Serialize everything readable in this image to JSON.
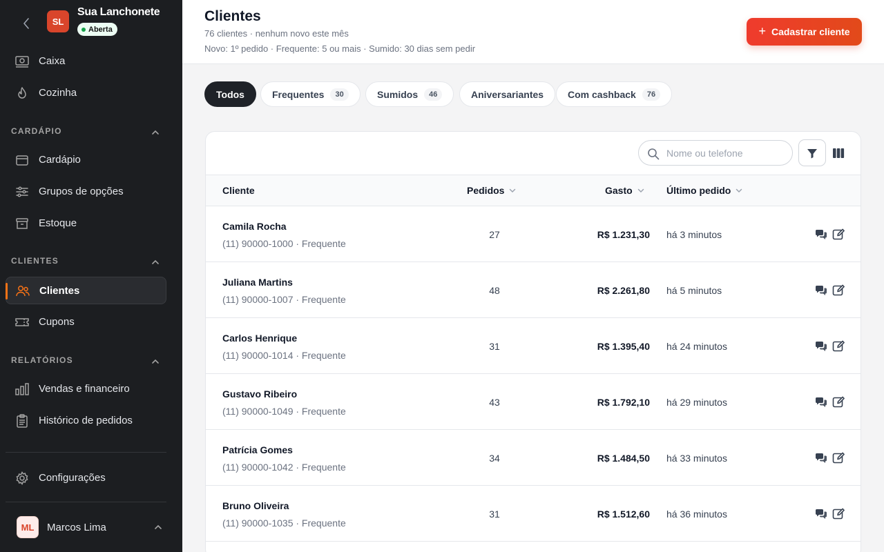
{
  "brand": {
    "initials": "SL",
    "name": "Sua Lanchonete",
    "status": "Aberta"
  },
  "nav": {
    "top": [
      {
        "label": "Caixa",
        "icon": "cash-register-icon"
      },
      {
        "label": "Cozinha",
        "icon": "flame-icon"
      }
    ],
    "sections": [
      {
        "title": "CARDÁPIO",
        "items": [
          {
            "label": "Cardápio",
            "icon": "bowl-icon"
          },
          {
            "label": "Grupos de opções",
            "icon": "sliders-icon"
          },
          {
            "label": "Estoque",
            "icon": "archive-icon"
          }
        ]
      },
      {
        "title": "CLIENTES",
        "items": [
          {
            "label": "Clientes",
            "icon": "users-icon",
            "active": true
          },
          {
            "label": "Cupons",
            "icon": "ticket-icon"
          }
        ]
      },
      {
        "title": "RELATÓRIOS",
        "items": [
          {
            "label": "Vendas e financeiro",
            "icon": "bar-chart-icon"
          },
          {
            "label": "Histórico de pedidos",
            "icon": "clipboard-icon"
          }
        ]
      }
    ],
    "settings": "Configurações"
  },
  "user": {
    "initials": "ML",
    "name": "Marcos Lima"
  },
  "header": {
    "title": "Clientes",
    "subtitle": "76 clientes · nenhum novo este mês",
    "legend": "Novo: 1º pedido · Frequente: 5 ou mais · Sumido: 30 dias sem pedir",
    "cta": "Cadastrar cliente"
  },
  "tabs": [
    {
      "label": "Todos",
      "count": null,
      "active": true
    },
    {
      "label": "Frequentes",
      "count": "30"
    },
    {
      "label": "Sumidos",
      "count": "46"
    },
    {
      "label": "Aniversariantes",
      "count": null
    },
    {
      "label": "Com cashback",
      "count": "76"
    }
  ],
  "search": {
    "placeholder": "Nome ou telefone"
  },
  "table": {
    "columns": {
      "cliente": "Cliente",
      "pedidos": "Pedidos",
      "gasto": "Gasto",
      "ultimo": "Último pedido"
    },
    "rows": [
      {
        "name": "Camila Rocha",
        "meta": "(11) 90000-1000 · Frequente",
        "orders": "27",
        "spent": "R$ 1.231,30",
        "last": "há 3 minutos"
      },
      {
        "name": "Juliana Martins",
        "meta": "(11) 90000-1007 · Frequente",
        "orders": "48",
        "spent": "R$ 2.261,80",
        "last": "há 5 minutos"
      },
      {
        "name": "Carlos Henrique",
        "meta": "(11) 90000-1014 · Frequente",
        "orders": "31",
        "spent": "R$ 1.395,40",
        "last": "há 24 minutos"
      },
      {
        "name": "Gustavo Ribeiro",
        "meta": "(11) 90000-1049 · Frequente",
        "orders": "43",
        "spent": "R$ 1.792,10",
        "last": "há 29 minutos"
      },
      {
        "name": "Patrícia Gomes",
        "meta": "(11) 90000-1042 · Frequente",
        "orders": "34",
        "spent": "R$ 1.484,50",
        "last": "há 33 minutos"
      },
      {
        "name": "Bruno Oliveira",
        "meta": "(11) 90000-1035 · Frequente",
        "orders": "31",
        "spent": "R$ 1.512,60",
        "last": "há 36 minutos"
      }
    ]
  },
  "colors": {
    "accent": "#f97316",
    "cta": "#e63b2a",
    "sidebar": "#1c1e21"
  }
}
